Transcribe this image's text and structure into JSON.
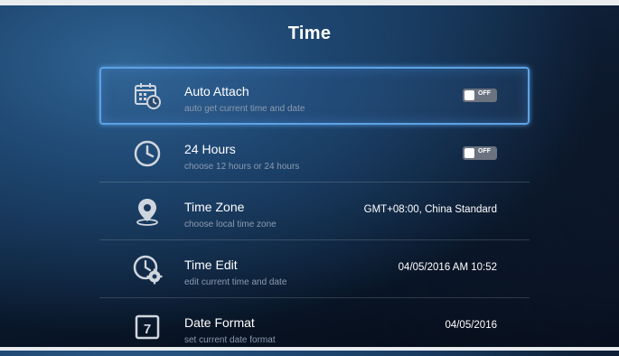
{
  "page": {
    "title": "Time"
  },
  "settings": [
    {
      "title": "Auto Attach",
      "subtitle": "auto get current time and date",
      "toggle": "OFF",
      "icon": "calendar-clock-icon"
    },
    {
      "title": "24 Hours",
      "subtitle": "choose 12 hours or 24 hours",
      "toggle": "OFF",
      "icon": "clock-icon"
    },
    {
      "title": "Time Zone",
      "subtitle": "choose local time zone",
      "value": "GMT+08:00, China Standard",
      "icon": "location-pin-icon"
    },
    {
      "title": "Time Edit",
      "subtitle": "edit current time and date",
      "value": "04/05/2016 AM 10:52",
      "icon": "clock-settings-icon"
    },
    {
      "title": "Date Format",
      "subtitle": "set current date format",
      "value": "04/05/2016",
      "icon": "calendar-day-icon",
      "icon_text": "7"
    }
  ],
  "colors": {
    "focus": "#5da2e4",
    "subtitle": "#8c9bb0",
    "toggle_off": "#6b7280"
  }
}
